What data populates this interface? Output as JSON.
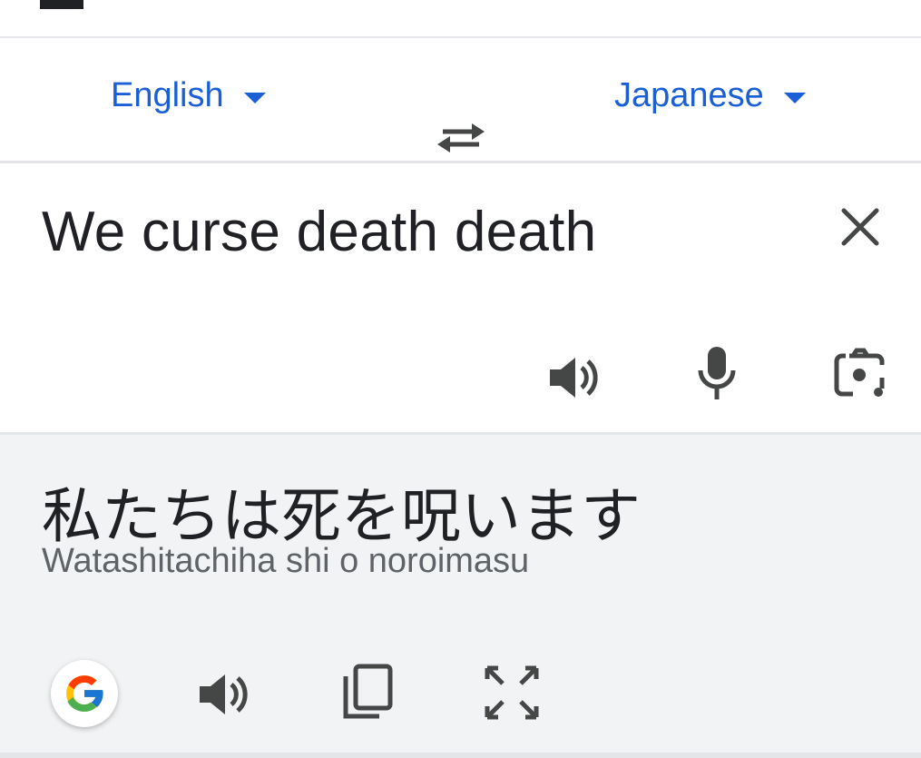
{
  "languages": {
    "source": "English",
    "target": "Japanese"
  },
  "input": {
    "text": "We curse death death"
  },
  "output": {
    "translation": "私たちは死を呪います",
    "romanization": "Watashitachiha shi o noroimasu"
  },
  "colors": {
    "accent": "#1a5fd6",
    "text": "#202124",
    "secondary_text": "#5f6368",
    "output_background": "#f1f3f4",
    "icon": "#444746"
  }
}
